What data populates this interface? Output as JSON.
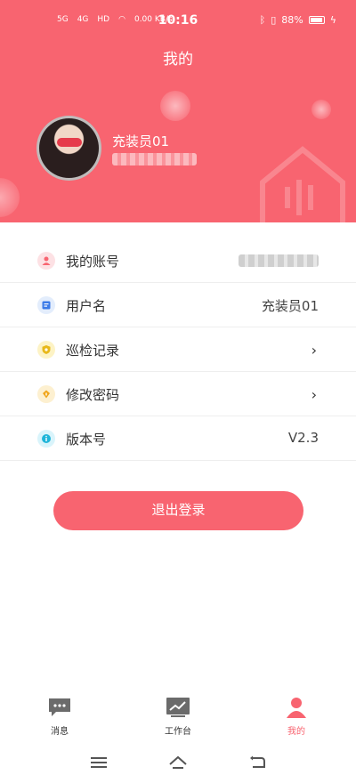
{
  "status_bar": {
    "net1": "5G",
    "net2": "4G",
    "hd": "HD",
    "speed": "0.00 KB/s",
    "time": "10:16",
    "battery": "88%"
  },
  "header": {
    "title": "我的",
    "user_name": "充装员01",
    "account_blurred": "**********"
  },
  "menu": {
    "account": {
      "label": "我的账号",
      "value": "**********"
    },
    "username": {
      "label": "用户名",
      "value": "充装员01"
    },
    "patrol": {
      "label": "巡检记录"
    },
    "password": {
      "label": "修改密码"
    },
    "version": {
      "label": "版本号",
      "value": "V2.3"
    }
  },
  "logout_label": "退出登录",
  "tabbar": {
    "messages": "消息",
    "workbench": "工作台",
    "mine": "我的"
  },
  "colors": {
    "accent": "#f86470"
  }
}
